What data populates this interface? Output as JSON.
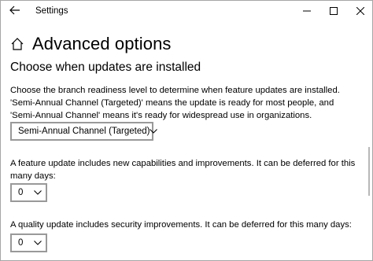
{
  "window": {
    "app_title": "Settings",
    "icons": {
      "back": "back-arrow-icon",
      "minimize": "minimize-icon",
      "maximize": "maximize-icon",
      "close": "close-icon",
      "home": "home-icon",
      "dropdown": "chevron-down-icon"
    }
  },
  "page": {
    "title": "Advanced options",
    "section_title": "Choose when updates are installed",
    "branch_description": "Choose the branch readiness level to determine when feature updates are installed. 'Semi-Annual Channel (Targeted)' means the update is ready for most people, and 'Semi-Annual Channel' means it's ready for widespread use in organizations.",
    "branch_dropdown_value": "Semi-Annual Channel (Targeted)",
    "feature_description": "A feature update includes new capabilities and improvements. It can be deferred for this many days:",
    "feature_dropdown_value": "0",
    "quality_description": "A quality update includes security improvements. It can be deferred for this many days:",
    "quality_dropdown_value": "0"
  },
  "colors": {
    "border": "#999999",
    "text": "#000000",
    "background": "#ffffff"
  }
}
